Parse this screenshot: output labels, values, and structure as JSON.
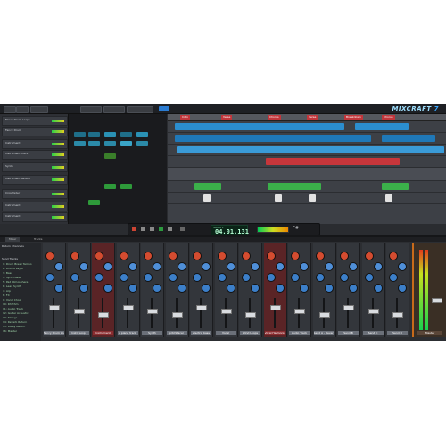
{
  "app": {
    "logo_text": "MIXCRAFT",
    "logo_number": "7"
  },
  "left_panel": {
    "tracks": [
      {
        "name": "Fancy Drum Loops"
      },
      {
        "name": "Fancy Drum"
      },
      {
        "name": "Instrument"
      },
      {
        "name": "Instrument Track"
      },
      {
        "name": "Synth"
      },
      {
        "name": "Instrument Reverb"
      },
      {
        "name": "Crossfader"
      },
      {
        "name": "Instrument"
      },
      {
        "name": "Instrument"
      }
    ]
  },
  "arrangement": {
    "markers": [
      "Intro",
      "Verse",
      "Chorus",
      "Verse",
      "Breakdown",
      "Chorus"
    ]
  },
  "transport": {
    "time_label": "SONG 1",
    "time_value": "04.01.131",
    "indicator": "F#"
  },
  "mixer": {
    "tabs": [
      "Mixer",
      "Tracks"
    ],
    "sidebar_title_1": "Return Channels",
    "sidebar_title_2": "Send Tracks",
    "sidebar_items": [
      "1: Drum Break Tempo",
      "2: Drums Layer",
      "3: Bass",
      "4: Synth Bass",
      "5: Pad Atmosphere",
      "6: Lead Synth",
      "7: Arp",
      "8: FX",
      "9: Vocal Chop",
      "10: Rhythm",
      "11: Audio Track",
      "12: Guitar Acoustic",
      "13: Strings",
      "14: Reverb Return",
      "15: Delay Return",
      "16: Master"
    ],
    "strips": [
      {
        "name": "Fancy Drum Loops",
        "accent": "#3b6fd8"
      },
      {
        "name": "Instr. Loop",
        "accent": "#3b6fd8"
      },
      {
        "name": "Instrument",
        "accent": "#c53a3a"
      },
      {
        "name": "a piano track",
        "accent": "#3b6fd8"
      },
      {
        "name": "Synth",
        "accent": "#3b6fd8"
      },
      {
        "name": "pitchRacer",
        "accent": "#3b6fd8"
      },
      {
        "name": "electric bass",
        "accent": "#3b6fd8"
      },
      {
        "name": "Vocal",
        "accent": "#3b6fd8"
      },
      {
        "name": "Wind Loops",
        "accent": "#3b6fd8"
      },
      {
        "name": "Vocal Harmonic",
        "accent": "#c53a3a"
      },
      {
        "name": "Audio Track",
        "accent": "#3b6fd8"
      },
      {
        "name": "Send A - Reverb",
        "accent": "#3b6fd8"
      },
      {
        "name": "Send B",
        "accent": "#3b6fd8"
      },
      {
        "name": "Send C",
        "accent": "#3b6fd8"
      },
      {
        "name": "Send D",
        "accent": "#3b6fd8"
      }
    ],
    "master_label": "Master"
  }
}
